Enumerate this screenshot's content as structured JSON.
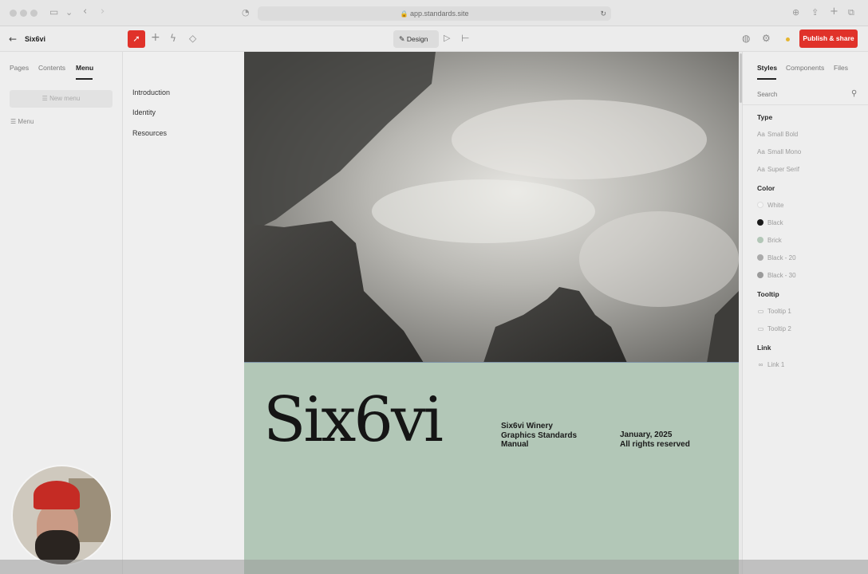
{
  "browser": {
    "url": "app.standards.site"
  },
  "toolbar": {
    "project_name": "Six6vi",
    "design_label": "Design",
    "publish_label": "Publish & share",
    "accent_color": "#e0322a"
  },
  "left_panel": {
    "tabs": [
      "Pages",
      "Contents",
      "Menu"
    ],
    "active_tab": "Menu",
    "new_menu_label": "New menu",
    "menu_item_label": "Menu"
  },
  "menu_panel": {
    "items": [
      "Introduction",
      "Identity",
      "Resources"
    ]
  },
  "canvas": {
    "logo": "Six6vi",
    "info_lines": [
      "Six6vi Winery",
      "Graphics Standards",
      "Manual"
    ],
    "date_lines": [
      "January, 2025",
      "All rights reserved"
    ],
    "bg_color": "#b2c7b7"
  },
  "right_panel": {
    "tabs": [
      "Styles",
      "Components",
      "Files"
    ],
    "active_tab": "Styles",
    "search_placeholder": "Search",
    "sections": {
      "type": {
        "title": "Type",
        "items": [
          "Small Bold",
          "Small Mono",
          "Super Serif"
        ]
      },
      "color": {
        "title": "Color",
        "items": [
          {
            "label": "White",
            "swatch": "#f4f4f4"
          },
          {
            "label": "Black",
            "swatch": "#1a1a1a"
          },
          {
            "label": "Brick",
            "swatch": "#b2c7b7"
          },
          {
            "label": "Black - 20",
            "swatch": "#aaaaaa"
          },
          {
            "label": "Black - 30",
            "swatch": "#9a9a9a"
          }
        ]
      },
      "tooltip": {
        "title": "Tooltip",
        "items": [
          "Tooltip 1",
          "Tooltip 2"
        ]
      },
      "link": {
        "title": "Link",
        "items": [
          "Link 1"
        ]
      }
    }
  }
}
